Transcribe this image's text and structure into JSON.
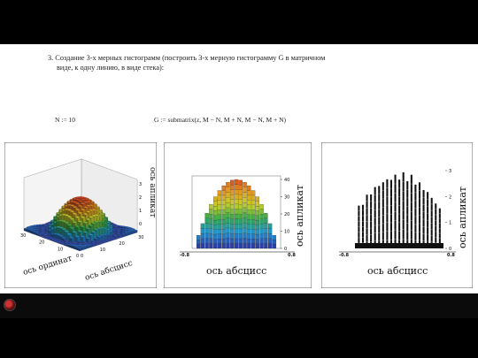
{
  "task": {
    "line1": "3. Создание 3-х мерных гистограмм (построить 3-х мерную гистограмму G в матричном",
    "line2": "виде, к одну линию, в виде стека):",
    "code_left": "N := 10",
    "code_right": "G := submatrix(z, M − N, M + N, M − N, M + N)"
  },
  "plot1": {
    "z_ticks": [
      "0",
      "1",
      "2",
      "3"
    ],
    "x_ticks": [
      "0",
      "10",
      "20",
      "30"
    ],
    "y_ticks": [
      "0",
      "10",
      "20",
      "30"
    ],
    "z_label": "ось апликат",
    "x_label": "ось ординат",
    "y_label": "ось абсцисс"
  },
  "plot2": {
    "y_ticks": [
      "0",
      "10",
      "20",
      "30",
      "40"
    ],
    "x_ticks": [
      "-0.8",
      "0.8"
    ],
    "x_label": "ось абсцисс",
    "y_label": "ось апликат"
  },
  "plot3": {
    "y_ticks": [
      "0",
      "1",
      "2",
      "3"
    ],
    "x_ticks": [
      "-0.8",
      "0.8"
    ],
    "x_label": "ось абсцисс",
    "y_label": "ось апликат"
  },
  "colors": {
    "background": "#000000",
    "slide": "#ffffff",
    "high": "#d23c1e",
    "mid": "#2ea84a",
    "low": "#2a3fa8"
  }
}
